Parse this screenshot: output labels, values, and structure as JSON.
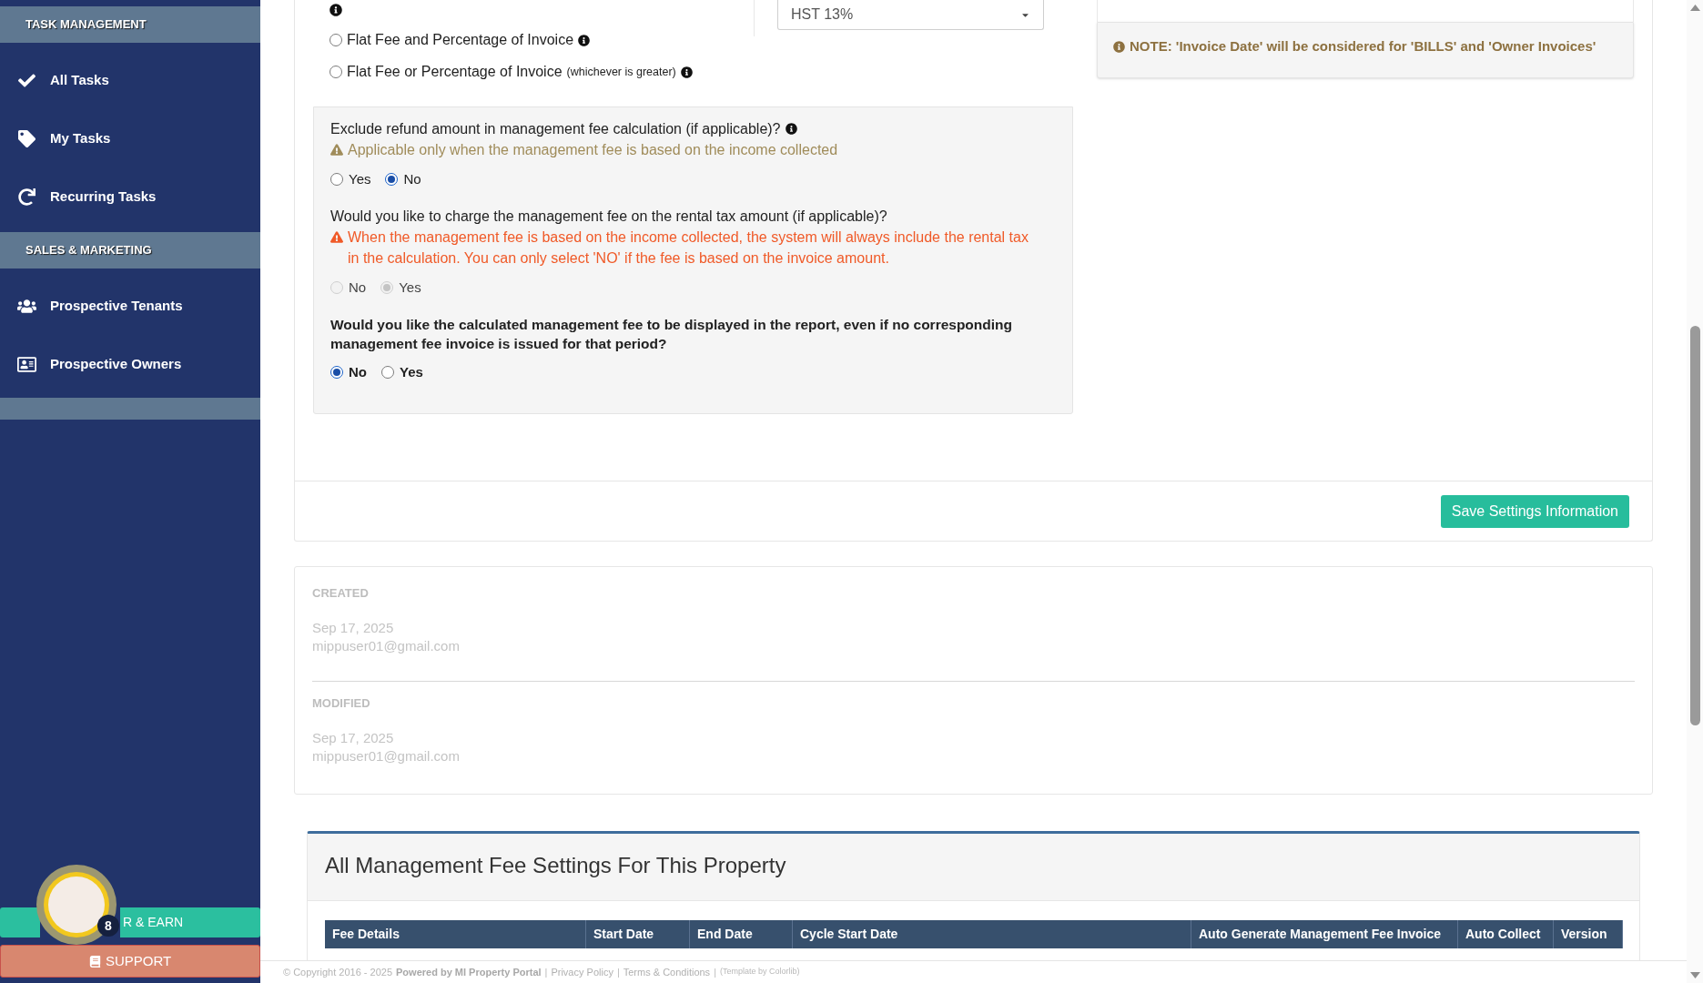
{
  "sidebar": {
    "sections": [
      {
        "title": "TASK MANAGEMENT",
        "items": [
          {
            "label": "All Tasks"
          },
          {
            "label": "My Tasks"
          },
          {
            "label": "Recurring Tasks"
          }
        ]
      },
      {
        "title": "SALES & MARKETING",
        "items": [
          {
            "label": "Prospective Tenants"
          },
          {
            "label": "Prospective Owners"
          }
        ]
      }
    ],
    "refer_button": {
      "label": "R & EARN"
    },
    "avatar_badge": "8",
    "support_button": {
      "label": "SUPPORT"
    }
  },
  "fee_form": {
    "fee_type_options": [
      {
        "label": "Flat Fee and Percentage of Invoice",
        "selected": false,
        "info_icon": true
      },
      {
        "label": "Flat Fee or Percentage of Invoice",
        "hint": "(whichever is greater)",
        "selected": false,
        "info_icon": true
      }
    ],
    "tax_select": {
      "value": "HST 13%"
    },
    "questions": [
      {
        "text": "Exclude refund amount in management fee calculation (if applicable)?",
        "info_icon": true,
        "bold": false,
        "warning": {
          "kind": "caution",
          "text": "Applicable only when the management fee is based on the income collected"
        },
        "options": [
          {
            "label": "Yes",
            "selected": false,
            "disabled": false
          },
          {
            "label": "No",
            "selected": true,
            "disabled": false
          }
        ]
      },
      {
        "text": "Would you like to charge the management fee on the rental tax amount (if applicable)?",
        "info_icon": false,
        "bold": false,
        "warning": {
          "kind": "danger",
          "text": "When the management fee is based on the income collected, the system will always include the rental tax in the calculation. You can only select 'NO' if the fee is based on the invoice amount."
        },
        "options": [
          {
            "label": "No",
            "selected": false,
            "disabled": true
          },
          {
            "label": "Yes",
            "selected": true,
            "disabled": true
          }
        ]
      },
      {
        "text": "Would you like the calculated management fee to be displayed in the report, even if no corresponding management fee invoice is issued for that period?",
        "info_icon": false,
        "bold": true,
        "options": [
          {
            "label": "No",
            "selected": true,
            "disabled": false
          },
          {
            "label": "Yes",
            "selected": false,
            "disabled": false
          }
        ]
      }
    ],
    "note": "NOTE: 'Invoice Date' will be considered for 'BILLS' and 'Owner Invoices'",
    "save_button": "Save Settings Information"
  },
  "audit": [
    {
      "label": "CREATED",
      "date": "Sep 17, 2025",
      "user": "mippuser01@gmail.com"
    },
    {
      "label": "MODIFIED",
      "date": "Sep 17, 2025",
      "user": "mippuser01@gmail.com"
    }
  ],
  "fee_settings_table": {
    "title": "All Management Fee Settings For This Property",
    "columns": [
      "Fee Details",
      "Start Date",
      "End Date",
      "Cycle Start Date",
      "Auto Generate Management Fee Invoice",
      "Auto Collect",
      "Version"
    ]
  },
  "footer": {
    "items": [
      {
        "kind": "text",
        "text": "© Copyright 2016 - 2025"
      },
      {
        "kind": "strong",
        "text": "Powered by MI Property Portal"
      },
      {
        "kind": "separator",
        "text": "|"
      },
      {
        "kind": "link",
        "text": "Privacy Policy"
      },
      {
        "kind": "separator",
        "text": "|"
      },
      {
        "kind": "link",
        "text": "Terms & Conditions"
      },
      {
        "kind": "separator",
        "text": "|"
      },
      {
        "kind": "credit",
        "text": "(Template by Colorlib)"
      }
    ]
  }
}
